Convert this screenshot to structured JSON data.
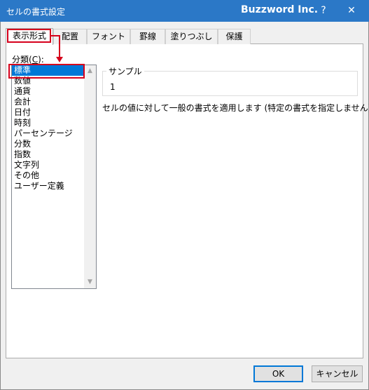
{
  "window": {
    "title": "セルの書式設定",
    "brand": "Buzzword Inc.",
    "help_label": "?",
    "close_label": "✕"
  },
  "tabs": [
    {
      "label": "表示形式",
      "active": true
    },
    {
      "label": "配置"
    },
    {
      "label": "フォント"
    },
    {
      "label": "罫線"
    },
    {
      "label": "塗りつぶし"
    },
    {
      "label": "保護"
    }
  ],
  "category": {
    "label_prefix": "分類(",
    "label_key": "C",
    "label_suffix": "):",
    "items": [
      "標準",
      "数値",
      "通貨",
      "会計",
      "日付",
      "時刻",
      "パーセンテージ",
      "分数",
      "指数",
      "文字列",
      "その他",
      "ユーザー定義"
    ],
    "selected": "標準"
  },
  "sample": {
    "legend": "サンプル",
    "value": "1"
  },
  "description": "セルの値に対して一般の書式を適用します (特定の書式を指定しません)。",
  "buttons": {
    "ok": "OK",
    "cancel": "キャンセル"
  },
  "colors": {
    "titlebar": "#2b78c7",
    "selection": "#0078d7",
    "annotation": "#d6001c"
  }
}
